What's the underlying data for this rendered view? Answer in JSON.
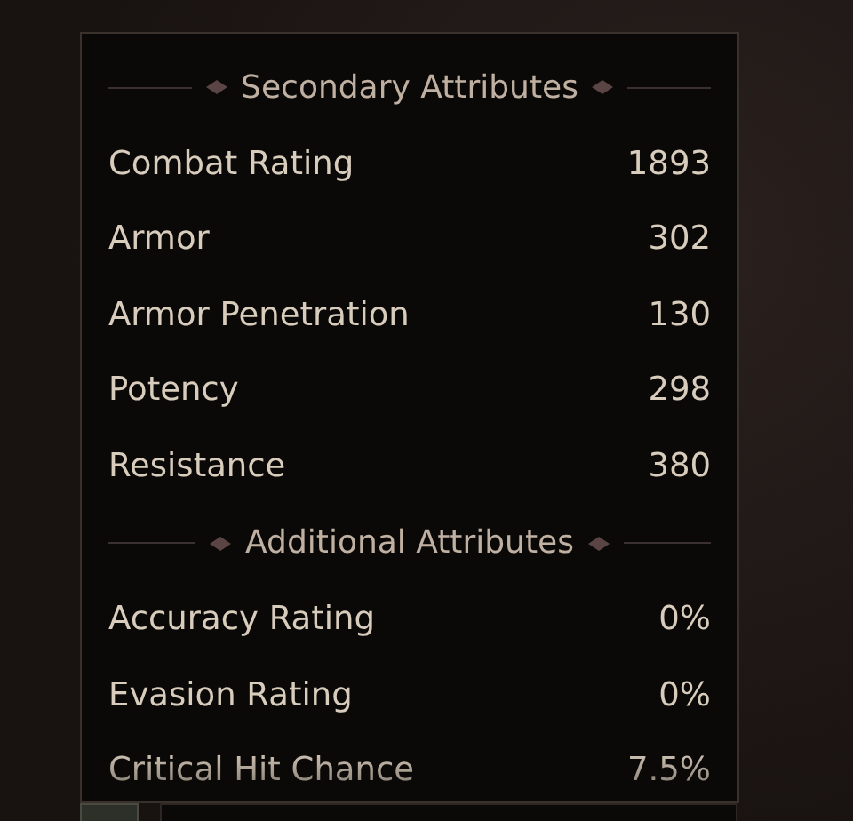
{
  "sections": [
    {
      "title": "Secondary Attributes",
      "rows": [
        {
          "label": "Combat Rating",
          "value": "1893"
        },
        {
          "label": "Armor",
          "value": "302"
        },
        {
          "label": "Armor Penetration",
          "value": "130"
        },
        {
          "label": "Potency",
          "value": "298"
        },
        {
          "label": "Resistance",
          "value": "380"
        }
      ]
    },
    {
      "title": "Additional Attributes",
      "rows": [
        {
          "label": "Accuracy Rating",
          "value": "0%"
        },
        {
          "label": "Evasion Rating",
          "value": "0%"
        },
        {
          "label": "Critical Hit Chance",
          "value": "7.5%"
        }
      ]
    }
  ]
}
